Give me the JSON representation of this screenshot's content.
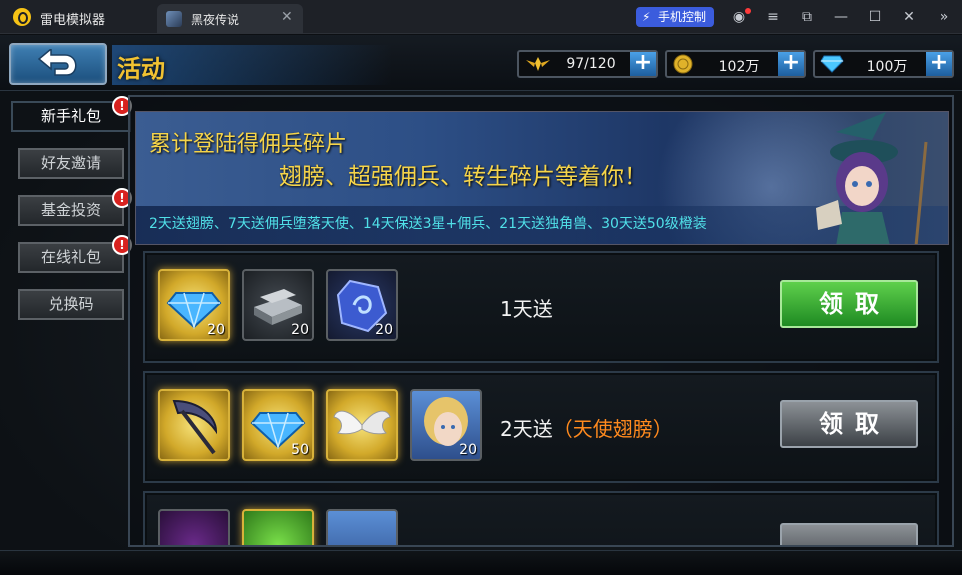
{
  "emulator": {
    "app_title": "雷电模拟器",
    "tab_label": "黑夜传说",
    "remote_control_label": "手机控制"
  },
  "topbar": {
    "page_title": "活动",
    "stamina": "97/120",
    "gold": "102万",
    "diamond": "100万"
  },
  "side_menu": [
    {
      "label": "新手礼包",
      "alert": "!"
    },
    {
      "label": "好友邀请",
      "alert": ""
    },
    {
      "label": "基金投资",
      "alert": "!"
    },
    {
      "label": "在线礼包",
      "alert": "!"
    },
    {
      "label": "兑换码",
      "alert": ""
    }
  ],
  "banner": {
    "line1": "累计登陆得佣兵碎片",
    "line2": "翅膀、超强佣兵、转生碎片等着你！",
    "line3": "2天送翅膀、7天送佣兵堕落天使、14天保送3星+佣兵、21天送独角兽、30天送50级橙装"
  },
  "rewards": [
    {
      "day_text": "1天送",
      "note": "",
      "claim_label": "领取",
      "items": [
        {
          "icon": "blue-diamond-icon",
          "count": "20"
        },
        {
          "icon": "iron-ingot-icon",
          "count": "20"
        },
        {
          "icon": "rune-stone-icon",
          "count": "20"
        }
      ]
    },
    {
      "day_text": "2天送",
      "note": "（天使翅膀）",
      "claim_label": "领取",
      "items": [
        {
          "icon": "scythe-icon",
          "count": ""
        },
        {
          "icon": "blue-diamond-icon",
          "count": "50"
        },
        {
          "icon": "angel-wings-icon",
          "count": ""
        },
        {
          "icon": "hero-portrait-icon",
          "count": "20"
        }
      ]
    }
  ],
  "colors": {
    "accent_gold": "#f1c232",
    "claim_green": "#2fa32c",
    "note_orange": "#ff8a1e",
    "banner_cyan": "#50e0e8"
  }
}
